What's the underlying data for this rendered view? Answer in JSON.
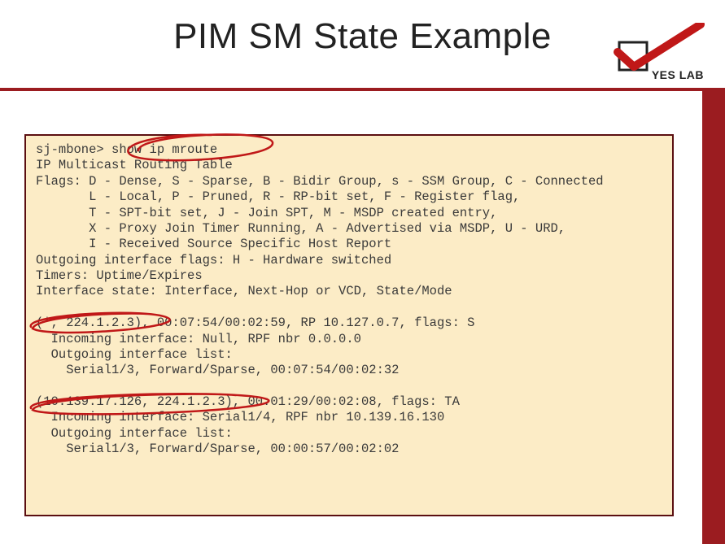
{
  "title": "PIM SM State Example",
  "logo_text": "YES LAB",
  "terminal": {
    "prompt": "sj-mbone> ",
    "command": "show ip mroute",
    "header": "IP Multicast Routing Table",
    "flags_lines": [
      "Flags: D - Dense, S - Sparse, B - Bidir Group, s - SSM Group, C - Connected",
      "       L - Local, P - Pruned, R - RP-bit set, F - Register flag,",
      "       T - SPT-bit set, J - Join SPT, M - MSDP created entry,",
      "       X - Proxy Join Timer Running, A - Advertised via MSDP, U - URD,",
      "       I - Received Source Specific Host Report"
    ],
    "oif_flags": "Outgoing interface flags: H - Hardware switched",
    "timers": "Timers: Uptime/Expires",
    "iface_state": "Interface state: Interface, Next-Hop or VCD, State/Mode",
    "entry1": {
      "head": "(*, 224.1.2.3), 00:07:54/00:02:59, RP 10.127.0.7, flags: S",
      "incoming": "  Incoming interface: Null, RPF nbr 0.0.0.0",
      "oil_label": "  Outgoing interface list:",
      "oil_item": "    Serial1/3, Forward/Sparse, 00:07:54/00:02:32"
    },
    "entry2": {
      "head": "(10.139.17.126, 224.1.2.3), 00:01:29/00:02:08, flags: TA",
      "incoming": "  Incoming interface: Serial1/4, RPF nbr 10.139.16.130",
      "oil_label": "  Outgoing interface list:",
      "oil_item": "    Serial1/3, Forward/Sparse, 00:00:57/00:02:02"
    }
  }
}
